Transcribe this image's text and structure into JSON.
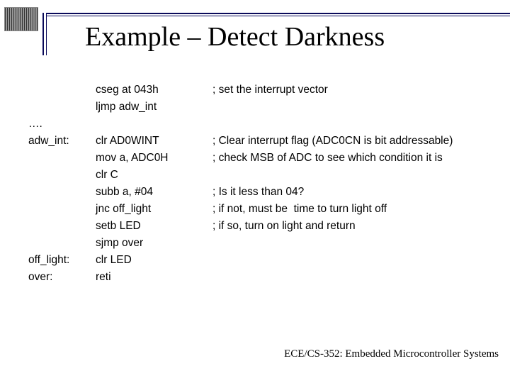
{
  "title": "Example – Detect Darkness",
  "footer": "ECE/CS-352: Embedded Microcontroller Systems",
  "code": {
    "rows": [
      {
        "label": "",
        "instr": "cseg at 043h",
        "comment": "; set the interrupt vector"
      },
      {
        "label": "",
        "instr": "ljmp adw_int",
        "comment": ""
      },
      {
        "label": "….",
        "instr": "",
        "comment": ""
      },
      {
        "label": "adw_int:",
        "instr": "clr AD0WINT",
        "comment": "; Clear interrupt flag (ADC0CN is bit addressable)"
      },
      {
        "label": "",
        "instr": "mov a, ADC0H",
        "comment": "; check MSB of ADC to see which condition it is"
      },
      {
        "label": "",
        "instr": "clr C",
        "comment": ""
      },
      {
        "label": "",
        "instr": "subb a, #04",
        "comment": "; Is it less than 04?"
      },
      {
        "label": "",
        "instr": "jnc off_light",
        "comment": "; if not, must be  time to turn light off"
      },
      {
        "label": "",
        "instr": "setb LED",
        "comment": "; if so, turn on light and return"
      },
      {
        "label": "",
        "instr": "sjmp over",
        "comment": ""
      },
      {
        "label": "off_light:",
        "instr": "clr LED",
        "comment": ""
      },
      {
        "label": "over:",
        "instr": "reti",
        "comment": ""
      }
    ]
  }
}
